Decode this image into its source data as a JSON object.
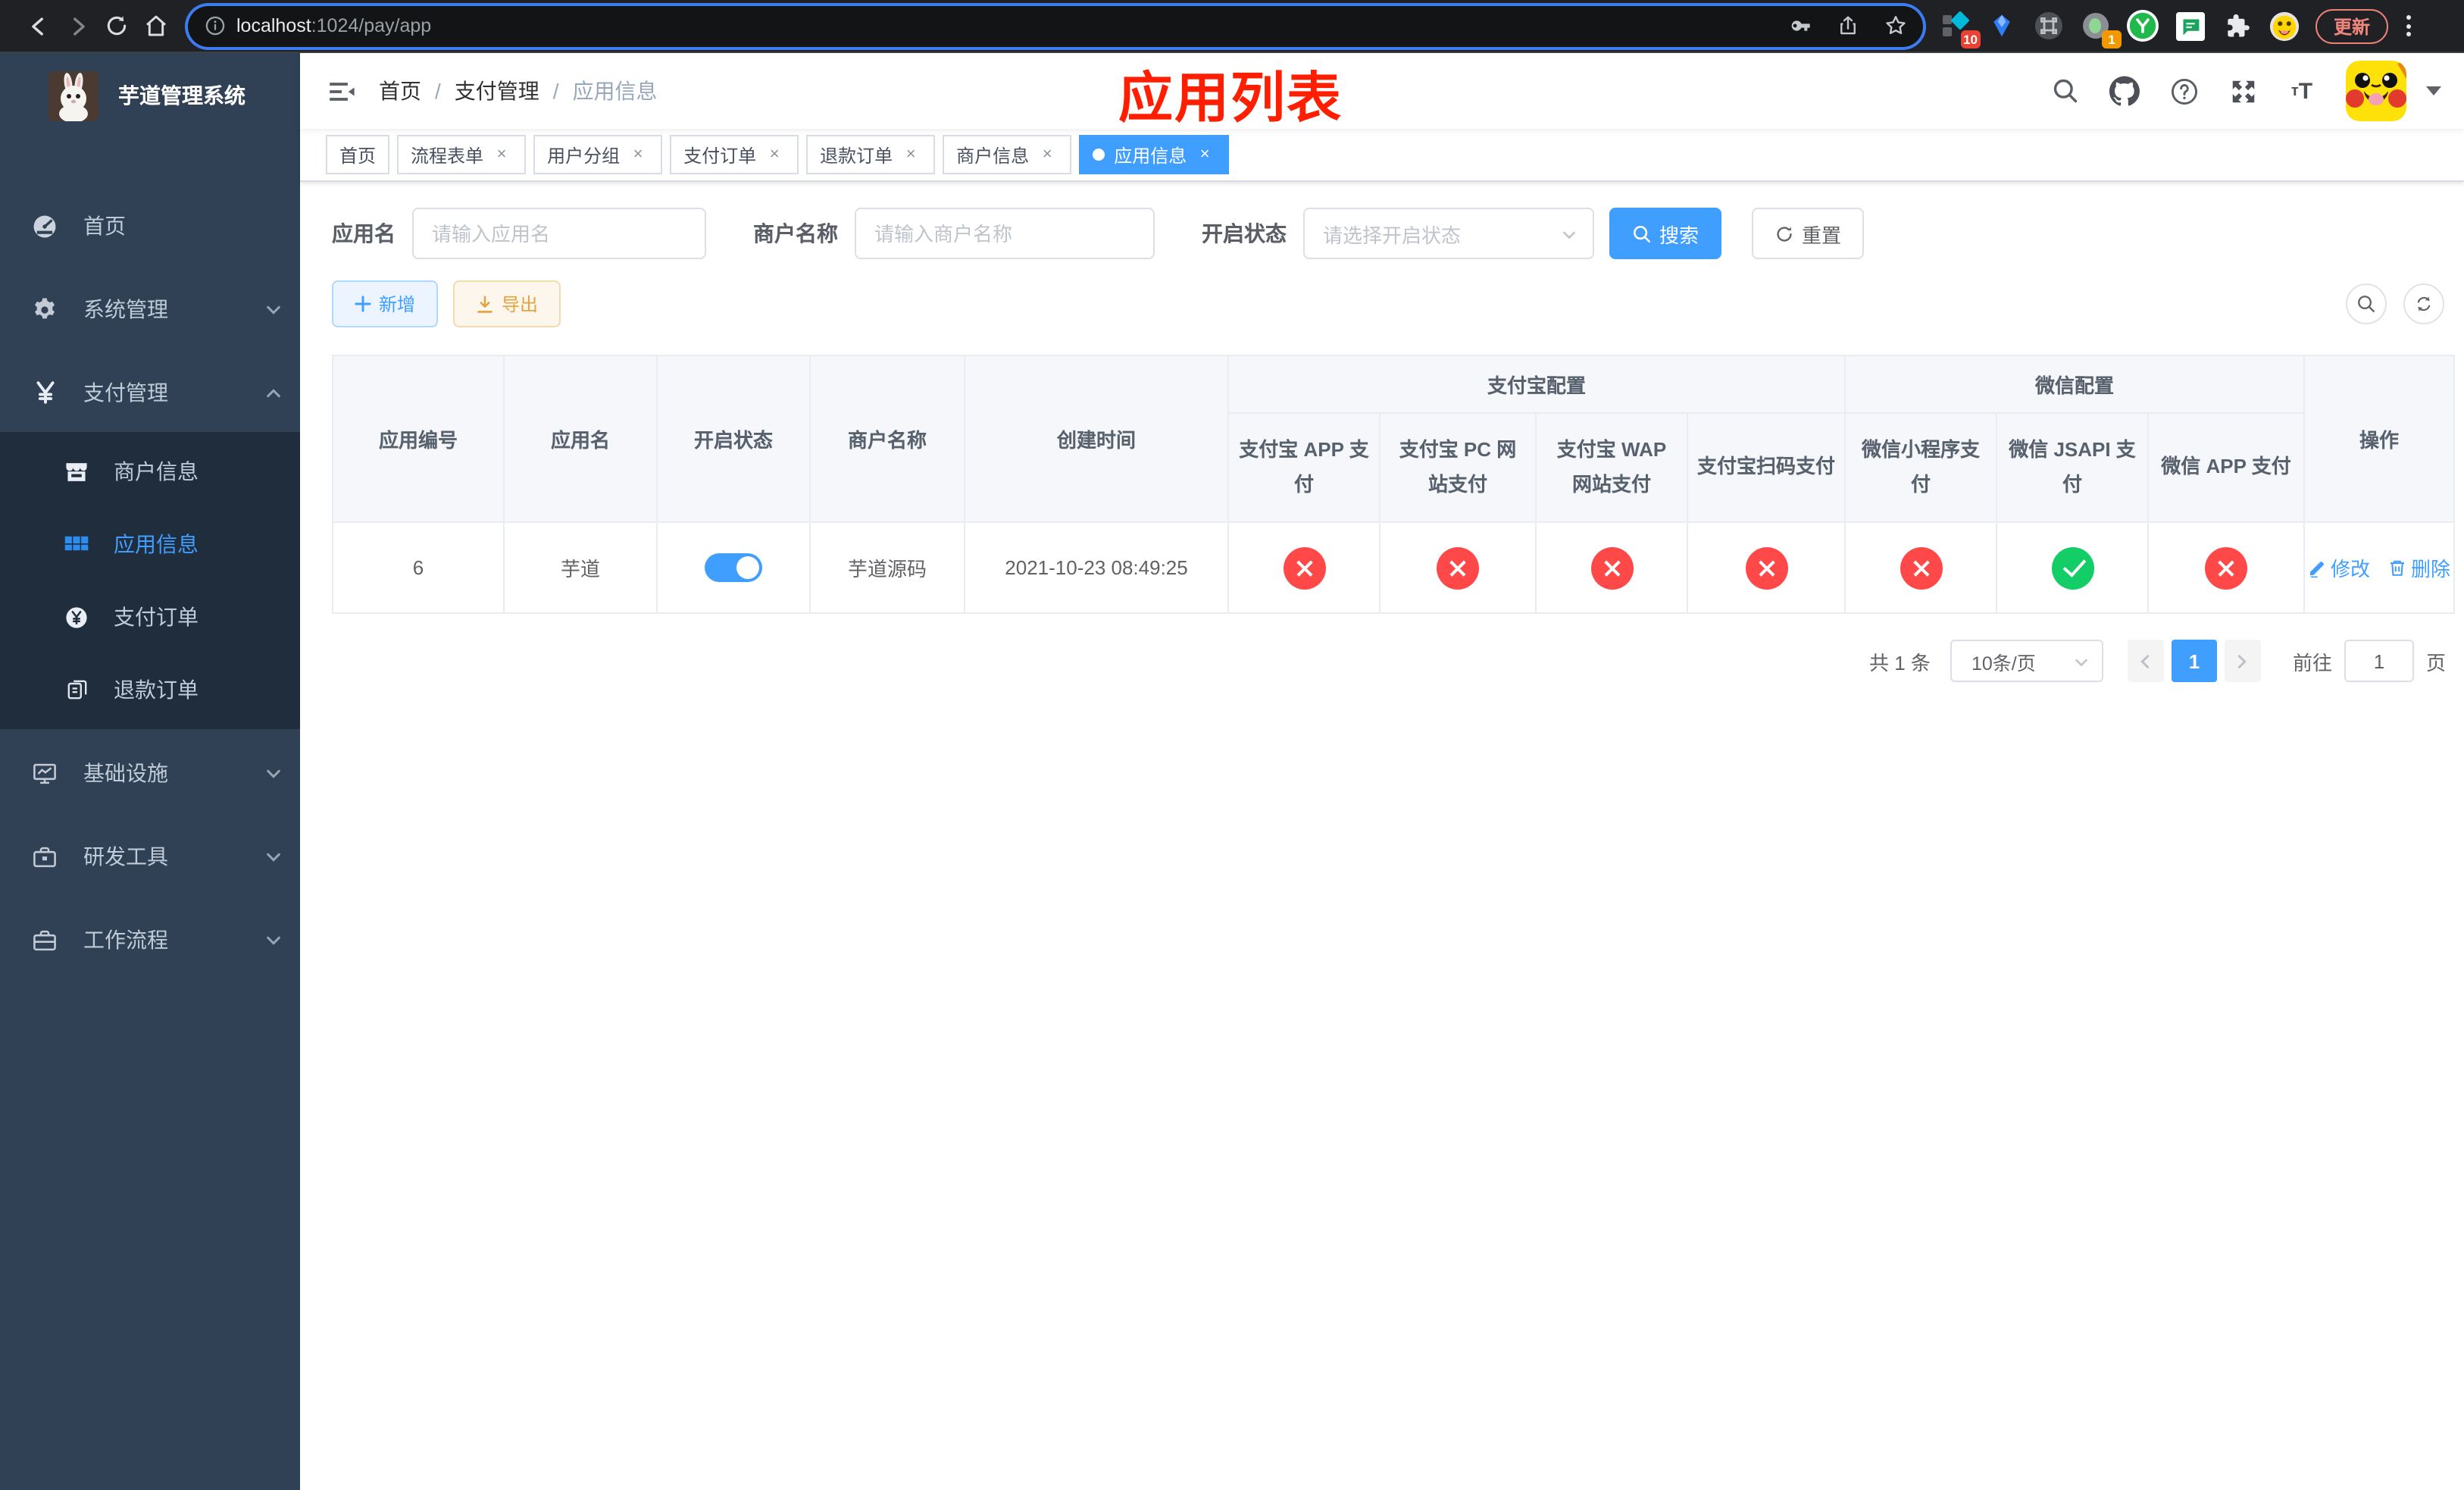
{
  "browser": {
    "url": {
      "host": "localhost",
      "rest": ":1024/pay/app"
    },
    "update_label": "更新",
    "badges": {
      "ext1": "10",
      "ext2": "1"
    }
  },
  "sidebar": {
    "app_title": "芋道管理系统",
    "menu": [
      {
        "label": "首页"
      },
      {
        "label": "系统管理"
      },
      {
        "label": "支付管理"
      },
      {
        "label": "商户信息"
      },
      {
        "label": "应用信息"
      },
      {
        "label": "支付订单"
      },
      {
        "label": "退款订单"
      },
      {
        "label": "基础设施"
      },
      {
        "label": "研发工具"
      },
      {
        "label": "工作流程"
      }
    ]
  },
  "navbar": {
    "breadcrumb": [
      {
        "label": "首页"
      },
      {
        "label": "支付管理"
      },
      {
        "label": "应用信息"
      }
    ]
  },
  "annotation": {
    "text": "应用列表"
  },
  "tags": [
    {
      "label": "首页"
    },
    {
      "label": "流程表单"
    },
    {
      "label": "用户分组"
    },
    {
      "label": "支付订单"
    },
    {
      "label": "退款订单"
    },
    {
      "label": "商户信息"
    },
    {
      "label": "应用信息"
    }
  ],
  "filters": {
    "app_name_label": "应用名",
    "app_name_placeholder": "请输入应用名",
    "merchant_label": "商户名称",
    "merchant_placeholder": "请输入商户名称",
    "status_label": "开启状态",
    "status_placeholder": "请选择开启状态",
    "search_label": "搜索",
    "reset_label": "重置"
  },
  "actions": {
    "add_label": "新增",
    "export_label": "导出"
  },
  "table": {
    "col_app_id": "应用编号",
    "col_app_name": "应用名",
    "col_status": "开启状态",
    "col_merchant": "商户名称",
    "col_created": "创建时间",
    "group_alipay": "支付宝配置",
    "group_wechat": "微信配置",
    "col_alipay_app": "支付宝 APP 支付",
    "col_alipay_pc": "支付宝 PC 网站支付",
    "col_alipay_wap": "支付宝 WAP 网站支付",
    "col_alipay_qr": "支付宝扫码支付",
    "col_wx_mini": "微信小程序支付",
    "col_wx_jsapi": "微信 JSAPI 支付",
    "col_wx_app": "微信 APP 支付",
    "col_actions": "操作",
    "row": {
      "app_id": "6",
      "app_name": "芋道",
      "enabled": true,
      "merchant": "芋道源码",
      "created": "2021-10-23 08:49:25",
      "alipay_app": "disabled",
      "alipay_pc": "disabled",
      "alipay_wap": "disabled",
      "alipay_qr": "disabled",
      "wx_mini": "disabled",
      "wx_jsapi": "enabled",
      "wx_app": "disabled",
      "edit_label": "修改",
      "delete_label": "删除"
    }
  },
  "pagination": {
    "total": "共 1 条",
    "page_size": "10条/页",
    "current_page": "1",
    "goto_label": "前往",
    "goto_value": "1",
    "page_suffix": "页"
  },
  "colors": {
    "accent": "#409eff",
    "success": "#13ce66",
    "danger": "#ff4949",
    "sidebar": "#304156",
    "submenu": "#1f2d3d"
  }
}
